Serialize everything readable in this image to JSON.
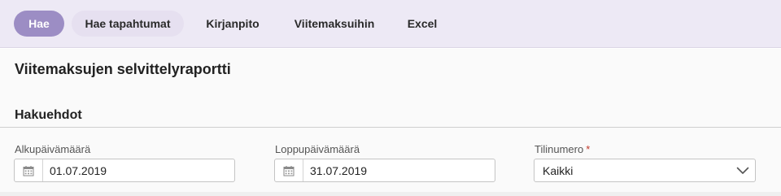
{
  "toolbar": {
    "search_label": "Hae",
    "search_events_label": "Hae tapahtumat",
    "accounting_label": "Kirjanpito",
    "reference_payments_label": "Viitemaksuihin",
    "excel_label": "Excel"
  },
  "page": {
    "title": "Viitemaksujen selvittelyraportti",
    "section_title": "Hakuehdot"
  },
  "form": {
    "start_date": {
      "label": "Alkupäivämäärä",
      "value": "01.07.2019"
    },
    "end_date": {
      "label": "Loppupäivämäärä",
      "value": "31.07.2019"
    },
    "account_number": {
      "label": "Tilinumero",
      "required_mark": "*",
      "value": "Kaikki"
    }
  },
  "colors": {
    "toolbar_bg": "#ede9f5",
    "primary_button": "#9c8dc4",
    "required": "#c0392b"
  },
  "icons": {
    "date_picker": "calendar-icon",
    "select_open": "chevron-down-icon"
  }
}
